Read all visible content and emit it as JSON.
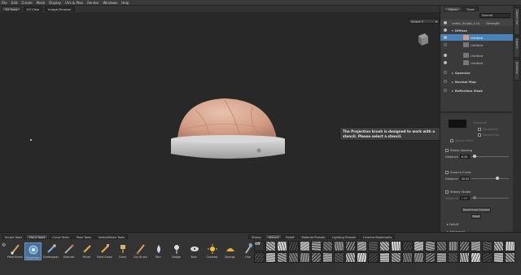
{
  "menu": [
    "File",
    "Edit",
    "Create",
    "Mesh",
    "Display",
    "UVs & Ptex",
    "Render",
    "Windows",
    "Help"
  ],
  "view_tabs": [
    "3D View",
    "UV View",
    "Image Browser"
  ],
  "viewport": {
    "camera": "Select C",
    "tooltip": "The Projection brush is designed to work with a stencil. Please select a stencil."
  },
  "right_panel": {
    "tabs": [
      "Object",
      "Paint"
    ],
    "layer_filter": "Normal",
    "object_name": "Lathe_Sculpt_1.cy",
    "blend": "Strength",
    "channel": "Diffuse",
    "layers": [
      "Untitled",
      "Untitled",
      "Untitled",
      "Untitled"
    ],
    "channels": [
      "Specular",
      "Normal Map",
      "Reflection Mask"
    ],
    "side_tabs": [
      "Object List",
      "Layers",
      "Visibility"
    ],
    "options": {
      "stamp_spacing_label": "Stamp Spacing",
      "distance_label": "Distance",
      "distance_value": "6.20",
      "snap_label": "Snap to Curve",
      "snap_distance_value": "40.00",
      "steady_label": "Steady Stroke",
      "steady_distance_value": "1.00",
      "reset_camera": "Reset from Camera",
      "reset": "Reset",
      "falloff": "Falloff",
      "advanced": "Advanced",
      "stamp_offset": "Stamp Offset",
      "projected_kind": "Grayscale",
      "scale_label": "Randomize",
      "vertical_label": "Vertical Flip"
    }
  },
  "shelf": {
    "left_tabs": [
      "Sculpt Tools",
      "Paint Tools",
      "Curve Tools",
      "Pose Tools",
      "Select/Move Tools"
    ],
    "active_left_tab": "Paint Tools",
    "tools": [
      {
        "name": "Paint Brush",
        "icon": "paint-brush-icon"
      },
      {
        "name": "Projection",
        "icon": "projection-icon"
      },
      {
        "name": "Eyedropper",
        "icon": "eyedropper-icon"
      },
      {
        "name": "Airbrush",
        "icon": "airbrush-icon"
      },
      {
        "name": "Pencil",
        "icon": "pencil-icon"
      },
      {
        "name": "Paint Erase",
        "icon": "eraser-icon"
      },
      {
        "name": "Clone",
        "icon": "clone-icon"
      },
      {
        "name": "Dry Brush",
        "icon": "dry-brush-icon"
      },
      {
        "name": "Blur",
        "icon": "blur-icon"
      },
      {
        "name": "Dodge",
        "icon": "dodge-icon"
      },
      {
        "name": "Burn",
        "icon": "burn-icon"
      },
      {
        "name": "Contrast",
        "icon": "contrast-icon"
      },
      {
        "name": "Sponge",
        "icon": "sponge-icon"
      },
      {
        "name": "Hue",
        "icon": "hue-icon"
      }
    ],
    "active_tool": "Projection",
    "right_tabs": [
      "Stamp",
      "Stencil",
      "Falloff",
      "Material Presets",
      "Lighting Presets",
      "Camera Bookmarks"
    ],
    "active_right_tab": "Stencil",
    "off_label": "Off"
  },
  "colors": {
    "accent": "#4a82b8",
    "dome": "#d9a48e",
    "rim": "#cfcfcf"
  }
}
